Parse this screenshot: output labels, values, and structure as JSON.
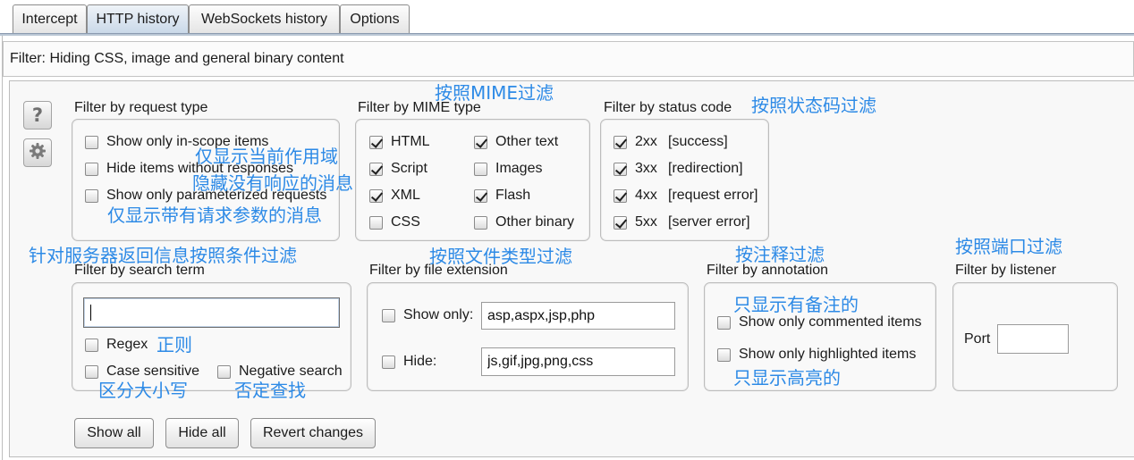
{
  "tabs": {
    "items": [
      {
        "label": "Intercept",
        "selected": false
      },
      {
        "label": "HTTP history",
        "selected": true
      },
      {
        "label": "WebSockets history",
        "selected": false
      },
      {
        "label": "Options",
        "selected": false
      }
    ]
  },
  "filter_bar": {
    "text": "Filter: Hiding CSS, image and general binary content"
  },
  "side": {
    "help_glyph": "?",
    "help_icon": "question-icon",
    "settings_icon": "gear-icon"
  },
  "request_type": {
    "title": "Filter by request type",
    "in_scope": {
      "label": "Show only in-scope items",
      "checked": false
    },
    "hide_no_response": {
      "label": "Hide items without responses",
      "checked": false
    },
    "parameterized": {
      "label": "Show only parameterized requests",
      "checked": false
    }
  },
  "mime_type": {
    "title": "Filter by MIME type",
    "html": {
      "label": "HTML",
      "checked": true
    },
    "script": {
      "label": "Script",
      "checked": true
    },
    "xml": {
      "label": "XML",
      "checked": true
    },
    "css": {
      "label": "CSS",
      "checked": false
    },
    "other_text": {
      "label": "Other text",
      "checked": true
    },
    "images": {
      "label": "Images",
      "checked": false
    },
    "flash": {
      "label": "Flash",
      "checked": true
    },
    "other_binary": {
      "label": "Other binary",
      "checked": false
    }
  },
  "status_code": {
    "title": "Filter by status code",
    "items": [
      {
        "code": "2xx",
        "desc": "[success]",
        "checked": true
      },
      {
        "code": "3xx",
        "desc": "[redirection]",
        "checked": true
      },
      {
        "code": "4xx",
        "desc": "[request error]",
        "checked": true
      },
      {
        "code": "5xx",
        "desc": "[server error]",
        "checked": true
      }
    ]
  },
  "search_term": {
    "title": "Filter by search term",
    "value": "",
    "regex": {
      "label": "Regex",
      "checked": false
    },
    "case_sensitive": {
      "label": "Case sensitive",
      "checked": false
    },
    "negative": {
      "label": "Negative search",
      "checked": false
    }
  },
  "file_extension": {
    "title": "Filter by file extension",
    "show_only": {
      "label": "Show only:",
      "checked": false,
      "value": "asp,aspx,jsp,php"
    },
    "hide": {
      "label": "Hide:",
      "checked": false,
      "value": "js,gif,jpg,png,css"
    }
  },
  "annotation": {
    "title": "Filter by annotation",
    "commented": {
      "label": "Show only commented items",
      "checked": false
    },
    "highlighted": {
      "label": "Show only highlighted items",
      "checked": false
    }
  },
  "listener": {
    "title": "Filter by listener",
    "port_label": "Port",
    "port_value": ""
  },
  "buttons": {
    "show_all": "Show all",
    "hide_all": "Hide all",
    "revert": "Revert changes"
  },
  "notes": {
    "mime": "按照MIME过滤",
    "status": "按照状态码过滤",
    "in_scope": "仅显示当前作用域",
    "hide_no_response": "隐藏没有响应的消息",
    "parameterized": "仅显示带有请求参数的消息",
    "server_response": "针对服务器返回信息按照条件过滤",
    "file_type": "按照文件类型过滤",
    "annotation": "按注释过滤",
    "port": "按照端口过滤",
    "commented": "只显示有备注的",
    "highlighted": "只显示高亮的",
    "regex": "正则",
    "case_sensitive": "区分大小写",
    "negative": "否定查找"
  },
  "colors": {
    "note_text": "#2d8ae6",
    "selected_tab": "#c9d8e8"
  }
}
